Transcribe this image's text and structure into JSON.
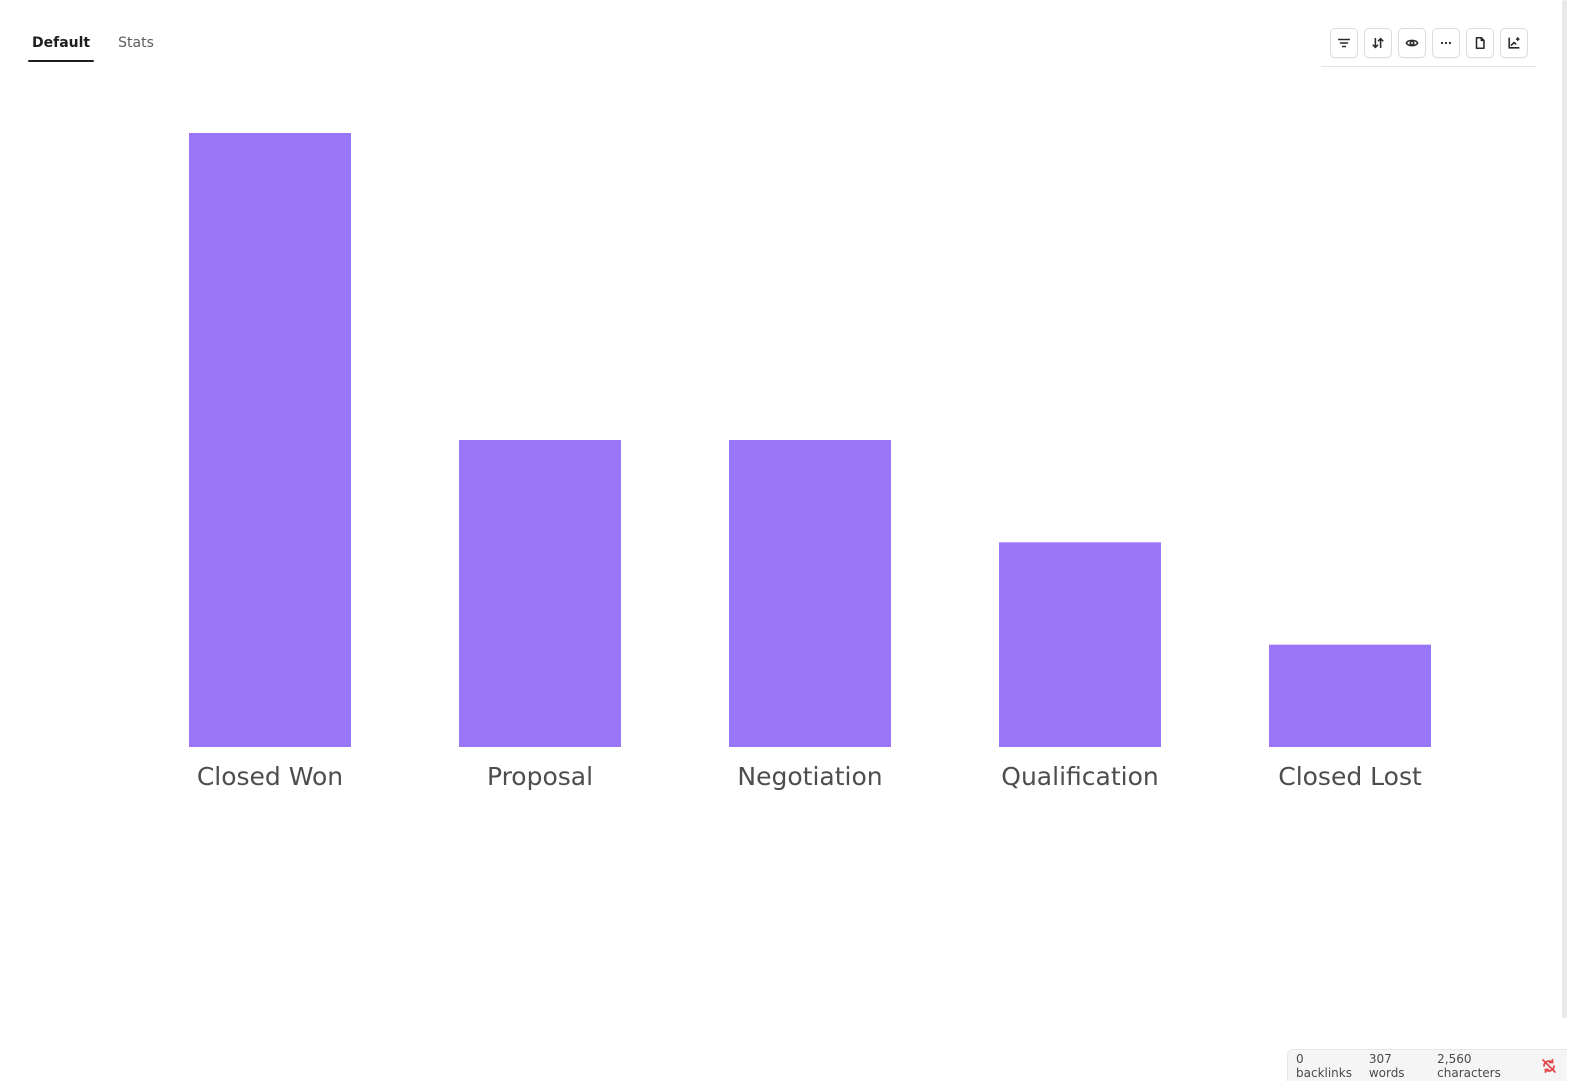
{
  "tabs": [
    {
      "label": "Default",
      "active": true
    },
    {
      "label": "Stats",
      "active": false
    }
  ],
  "toolbar": {
    "icons": [
      "filter-icon",
      "sort-icon",
      "eye-icon",
      "more-icon",
      "file-icon",
      "chart-export-icon"
    ]
  },
  "chart_data": {
    "type": "bar",
    "categories": [
      "Closed Won",
      "Proposal",
      "Negotiation",
      "Qualification",
      "Closed Lost"
    ],
    "values": [
      6,
      3,
      3,
      2,
      1
    ],
    "color": "#9975f7",
    "ylim": [
      0,
      6
    ],
    "grid": false,
    "title": "",
    "xlabel": "",
    "ylabel": ""
  },
  "status": {
    "backlinks": "0 backlinks",
    "words": "307 words",
    "characters": "2,560 characters",
    "sync_icon": "sync-off-icon",
    "sync_color": "#e5484d"
  }
}
